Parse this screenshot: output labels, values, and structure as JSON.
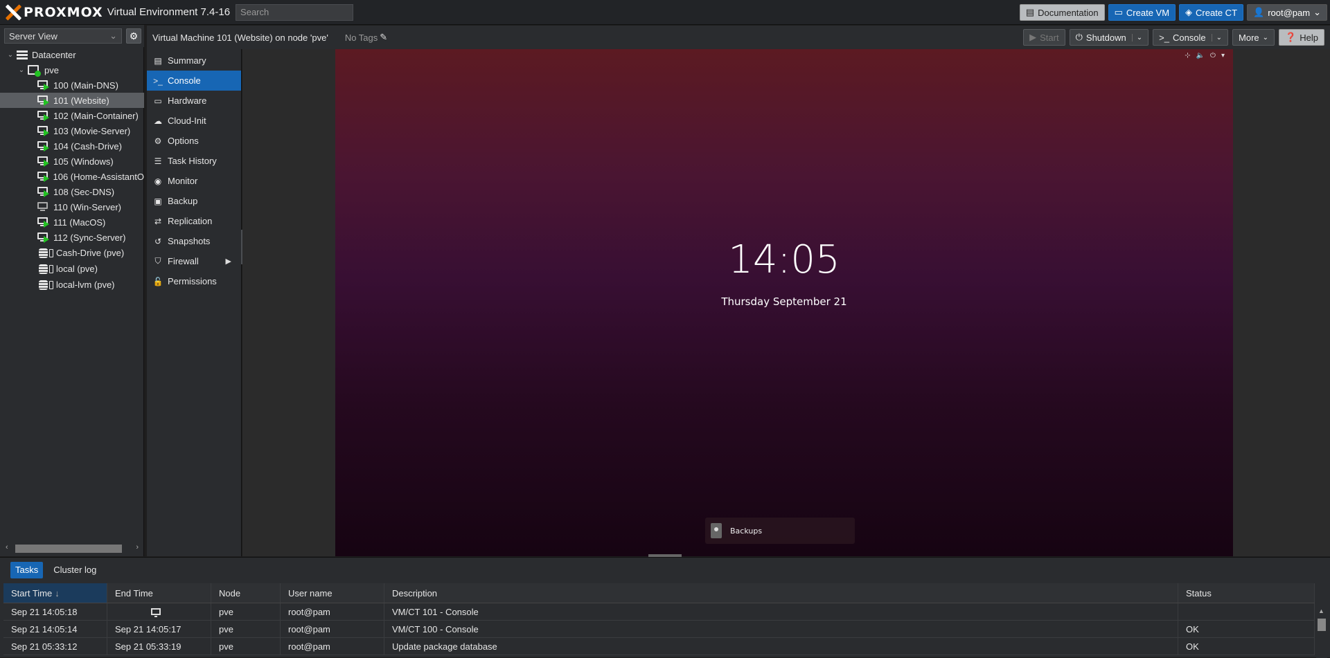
{
  "topbar": {
    "brand": "PROXMOX",
    "version": "Virtual Environment 7.4-16",
    "search_placeholder": "Search",
    "buttons": {
      "documentation": "Documentation",
      "create_vm": "Create VM",
      "create_ct": "Create CT",
      "user": "root@pam"
    }
  },
  "tree": {
    "view": "Server View",
    "datacenter": "Datacenter",
    "node": "pve",
    "guests": [
      {
        "label": "100 (Main-DNS)",
        "running": true
      },
      {
        "label": "101 (Website)",
        "running": true,
        "selected": true
      },
      {
        "label": "102 (Main-Container)",
        "running": true
      },
      {
        "label": "103 (Movie-Server)",
        "running": true
      },
      {
        "label": "104 (Cash-Drive)",
        "running": true
      },
      {
        "label": "105 (Windows)",
        "running": true
      },
      {
        "label": "106 (Home-AssistantO",
        "running": true
      },
      {
        "label": "108 (Sec-DNS)",
        "running": true
      },
      {
        "label": "110 (Win-Server)",
        "running": false
      },
      {
        "label": "111 (MacOS)",
        "running": true
      },
      {
        "label": "112 (Sync-Server)",
        "running": true
      }
    ],
    "storage": [
      "Cash-Drive (pve)",
      "local (pve)",
      "local-lvm (pve)"
    ]
  },
  "content": {
    "title": "Virtual Machine 101 (Website) on node 'pve'",
    "tags": "No Tags",
    "buttons": {
      "start": "Start",
      "shutdown": "Shutdown",
      "console": "Console",
      "more": "More",
      "help": "Help"
    }
  },
  "menu": [
    {
      "label": "Summary",
      "icon": "book-icon"
    },
    {
      "label": "Console",
      "icon": "terminal-icon",
      "active": true
    },
    {
      "label": "Hardware",
      "icon": "desktop-icon"
    },
    {
      "label": "Cloud-Init",
      "icon": "cloud-icon"
    },
    {
      "label": "Options",
      "icon": "gear-icon"
    },
    {
      "label": "Task History",
      "icon": "list-icon"
    },
    {
      "label": "Monitor",
      "icon": "eye-icon"
    },
    {
      "label": "Backup",
      "icon": "floppy-icon"
    },
    {
      "label": "Replication",
      "icon": "retweet-icon"
    },
    {
      "label": "Snapshots",
      "icon": "history-icon"
    },
    {
      "label": "Firewall",
      "icon": "shield-icon",
      "has_submenu": true
    },
    {
      "label": "Permissions",
      "icon": "unlock-icon"
    }
  ],
  "console_screen": {
    "time": "14:05",
    "date": "Thursday September 21",
    "notification": "Backups"
  },
  "log": {
    "tabs": [
      "Tasks",
      "Cluster log"
    ],
    "active_tab": "Tasks",
    "columns": [
      "Start Time",
      "End Time",
      "Node",
      "User name",
      "Description",
      "Status"
    ],
    "sorted_column": "Start Time",
    "sort_direction": "descending",
    "rows": [
      {
        "start": "Sep 21 14:05:18",
        "end": "",
        "running": true,
        "node": "pve",
        "user": "root@pam",
        "desc": "VM/CT 101 - Console",
        "status": ""
      },
      {
        "start": "Sep 21 14:05:14",
        "end": "Sep 21 14:05:17",
        "running": false,
        "node": "pve",
        "user": "root@pam",
        "desc": "VM/CT 100 - Console",
        "status": "OK"
      },
      {
        "start": "Sep 21 05:33:12",
        "end": "Sep 21 05:33:19",
        "running": false,
        "node": "pve",
        "user": "root@pam",
        "desc": "Update package database",
        "status": "OK"
      }
    ]
  },
  "colors": {
    "accent": "#1766b4",
    "running_green": "#22c322",
    "proxmox_orange": "#e57000"
  }
}
